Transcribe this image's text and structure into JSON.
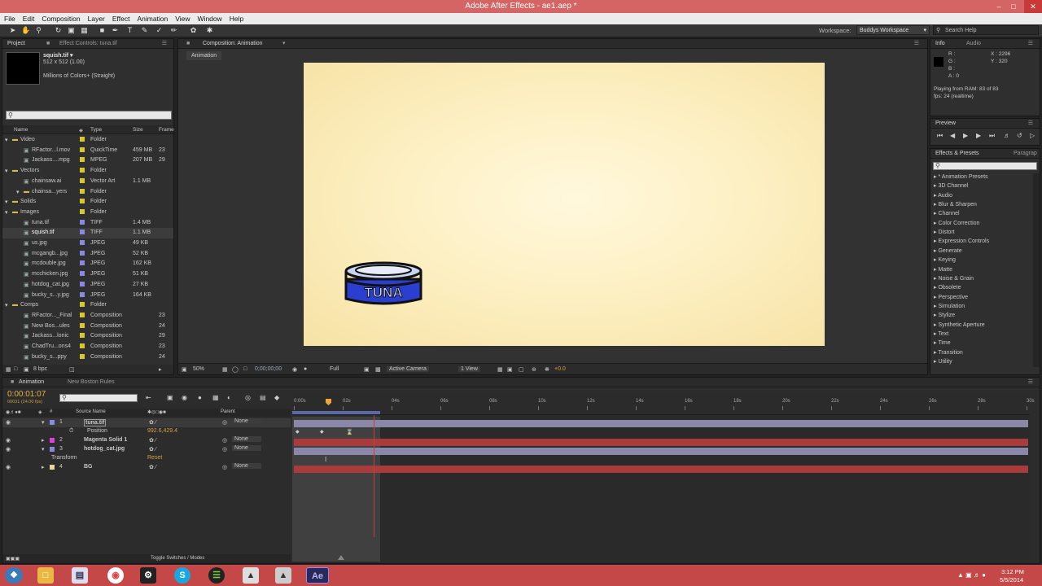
{
  "window": {
    "title": "Adobe After Effects - ae1.aep *"
  },
  "menu": [
    "File",
    "Edit",
    "Composition",
    "Layer",
    "Effect",
    "Animation",
    "View",
    "Window",
    "Help"
  ],
  "workspace": {
    "label": "Workspace:",
    "value": "Buddys Workspace",
    "search_placeholder": "Search Help"
  },
  "project": {
    "tab": "Project",
    "effect_tab": "Effect Controls: tuna.tif",
    "selected_name": "squish.tif ▾",
    "selected_dims": "512 x 512 (1.00)",
    "selected_colors": "Millions of Colors+ (Straight)",
    "columns": [
      "Name",
      "Type",
      "Size",
      "Frame"
    ],
    "items": [
      {
        "name": "Video",
        "type": "Folder",
        "size": "",
        "frame": "",
        "indent": 0,
        "folder": true,
        "color": "#d8c830"
      },
      {
        "name": "RFactor...l.mov",
        "type": "QuickTime",
        "size": "459 MB",
        "frame": "23",
        "indent": 1,
        "color": "#d8c830"
      },
      {
        "name": "Jackass....mpg",
        "type": "MPEG",
        "size": "207 MB",
        "frame": "29",
        "indent": 1,
        "color": "#d8c830"
      },
      {
        "name": "Vectors",
        "type": "Folder",
        "size": "",
        "frame": "",
        "indent": 0,
        "folder": true,
        "color": "#d8c830"
      },
      {
        "name": "chainsaw.ai",
        "type": "Vector Art",
        "size": "1.1 MB",
        "frame": "",
        "indent": 1,
        "color": "#d8c830"
      },
      {
        "name": "chainsa...yers",
        "type": "Folder",
        "size": "",
        "frame": "",
        "indent": 1,
        "folder": true,
        "color": "#d8c830"
      },
      {
        "name": "Solids",
        "type": "Folder",
        "size": "",
        "frame": "",
        "indent": 0,
        "folder": true,
        "color": "#d8c830"
      },
      {
        "name": "Images",
        "type": "Folder",
        "size": "",
        "frame": "",
        "indent": 0,
        "folder": true,
        "color": "#d8c830"
      },
      {
        "name": "tuna.tif",
        "type": "TIFF",
        "size": "1.4 MB",
        "frame": "",
        "indent": 1,
        "color": "#8a8adc"
      },
      {
        "name": "squish.tif",
        "type": "TIFF",
        "size": "1.1 MB",
        "frame": "",
        "indent": 1,
        "color": "#8a8adc",
        "selected": true
      },
      {
        "name": "us.jpg",
        "type": "JPEG",
        "size": "49 KB",
        "frame": "",
        "indent": 1,
        "color": "#8a8adc"
      },
      {
        "name": "mcgangb...jpg",
        "type": "JPEG",
        "size": "52 KB",
        "frame": "",
        "indent": 1,
        "color": "#8a8adc"
      },
      {
        "name": "mcdouble.jpg",
        "type": "JPEG",
        "size": "162 KB",
        "frame": "",
        "indent": 1,
        "color": "#8a8adc"
      },
      {
        "name": "mcchicken.jpg",
        "type": "JPEG",
        "size": "51 KB",
        "frame": "",
        "indent": 1,
        "color": "#8a8adc"
      },
      {
        "name": "hotdog_cat.jpg",
        "type": "JPEG",
        "size": "27 KB",
        "frame": "",
        "indent": 1,
        "color": "#8a8adc"
      },
      {
        "name": "bucky_s...y.jpg",
        "type": "JPEG",
        "size": "164 KB",
        "frame": "",
        "indent": 1,
        "color": "#8a8adc"
      },
      {
        "name": "Comps",
        "type": "Folder",
        "size": "",
        "frame": "",
        "indent": 0,
        "folder": true,
        "color": "#d8c830"
      },
      {
        "name": "RFactor..._Final",
        "type": "Composition",
        "size": "",
        "frame": "23",
        "indent": 1,
        "color": "#d8c830"
      },
      {
        "name": "New Bos...ules",
        "type": "Composition",
        "size": "",
        "frame": "24",
        "indent": 1,
        "color": "#d8c830"
      },
      {
        "name": "Jackass...lonic",
        "type": "Composition",
        "size": "",
        "frame": "29",
        "indent": 1,
        "color": "#d8c830"
      },
      {
        "name": "ChadTru...ons4",
        "type": "Composition",
        "size": "",
        "frame": "23",
        "indent": 1,
        "color": "#d8c830"
      },
      {
        "name": "bucky_s...ppy",
        "type": "Composition",
        "size": "",
        "frame": "24",
        "indent": 1,
        "color": "#d8c830"
      }
    ],
    "bpc": "8 bpc"
  },
  "composition": {
    "tab": "Composition: Animation",
    "subtab": "Animation",
    "canvas_text": "TUNA",
    "zoom": "50%",
    "timecode": "0;00;00;00",
    "resolution": "Full",
    "camera": "Active Camera",
    "view": "1 View",
    "exposure": "+0.0"
  },
  "info": {
    "tab_info": "Info",
    "tab_audio": "Audio",
    "r": "R :",
    "g": "G :",
    "b": "B :",
    "a": "A : 0",
    "x": "X : 2296",
    "y": "Y : 320",
    "playing": "Playing from RAM: 83 of 83",
    "fps": "fps: 24 (realtime)"
  },
  "preview": {
    "tab": "Preview"
  },
  "effects": {
    "tab": "Effects & Presets",
    "tab2": "Paragrap",
    "items": [
      "* Animation Presets",
      "3D Channel",
      "Audio",
      "Blur & Sharpen",
      "Channel",
      "Color Correction",
      "Distort",
      "Expression Controls",
      "Generate",
      "Keying",
      "Matte",
      "Noise & Grain",
      "Obsolete",
      "Perspective",
      "Simulation",
      "Stylize",
      "Synthetic Aperture",
      "Text",
      "Time",
      "Transition",
      "Utility"
    ]
  },
  "timeline": {
    "tab": "Animation",
    "tab2": "New Boston Rules",
    "timecode": "0:00:01:07",
    "frames": "00031 (24.00 fps)",
    "col_source": "Source Name",
    "col_parent": "Parent",
    "ruler": [
      "0:00s",
      "02s",
      "04s",
      "06s",
      "08s",
      "10s",
      "12s",
      "14s",
      "16s",
      "18s",
      "20s",
      "22s",
      "24s",
      "26s",
      "28s",
      "30s"
    ],
    "layers": [
      {
        "num": "1",
        "name": "tuna.tif",
        "parent": "None",
        "color": "#8a8adc",
        "bar": "#8a87a8"
      },
      {
        "num": "2",
        "name": "Magenta Solid 1",
        "parent": "None",
        "color": "#e040e0",
        "bar": "#a83c3c"
      },
      {
        "num": "3",
        "name": "hotdog_cat.jpg",
        "parent": "None",
        "color": "#8a8adc",
        "bar": "#8a87a8"
      },
      {
        "num": "4",
        "name": "BG",
        "parent": "None",
        "color": "#e8d89c",
        "bar": "#a83c3c"
      }
    ],
    "position_label": "Position",
    "position_value": "992.6,429.4",
    "transform_label": "Transform",
    "reset_label": "Reset",
    "toggle_label": "Toggle Switches / Modes"
  },
  "taskbar": {
    "time": "3:12 PM",
    "date": "5/5/2014"
  }
}
